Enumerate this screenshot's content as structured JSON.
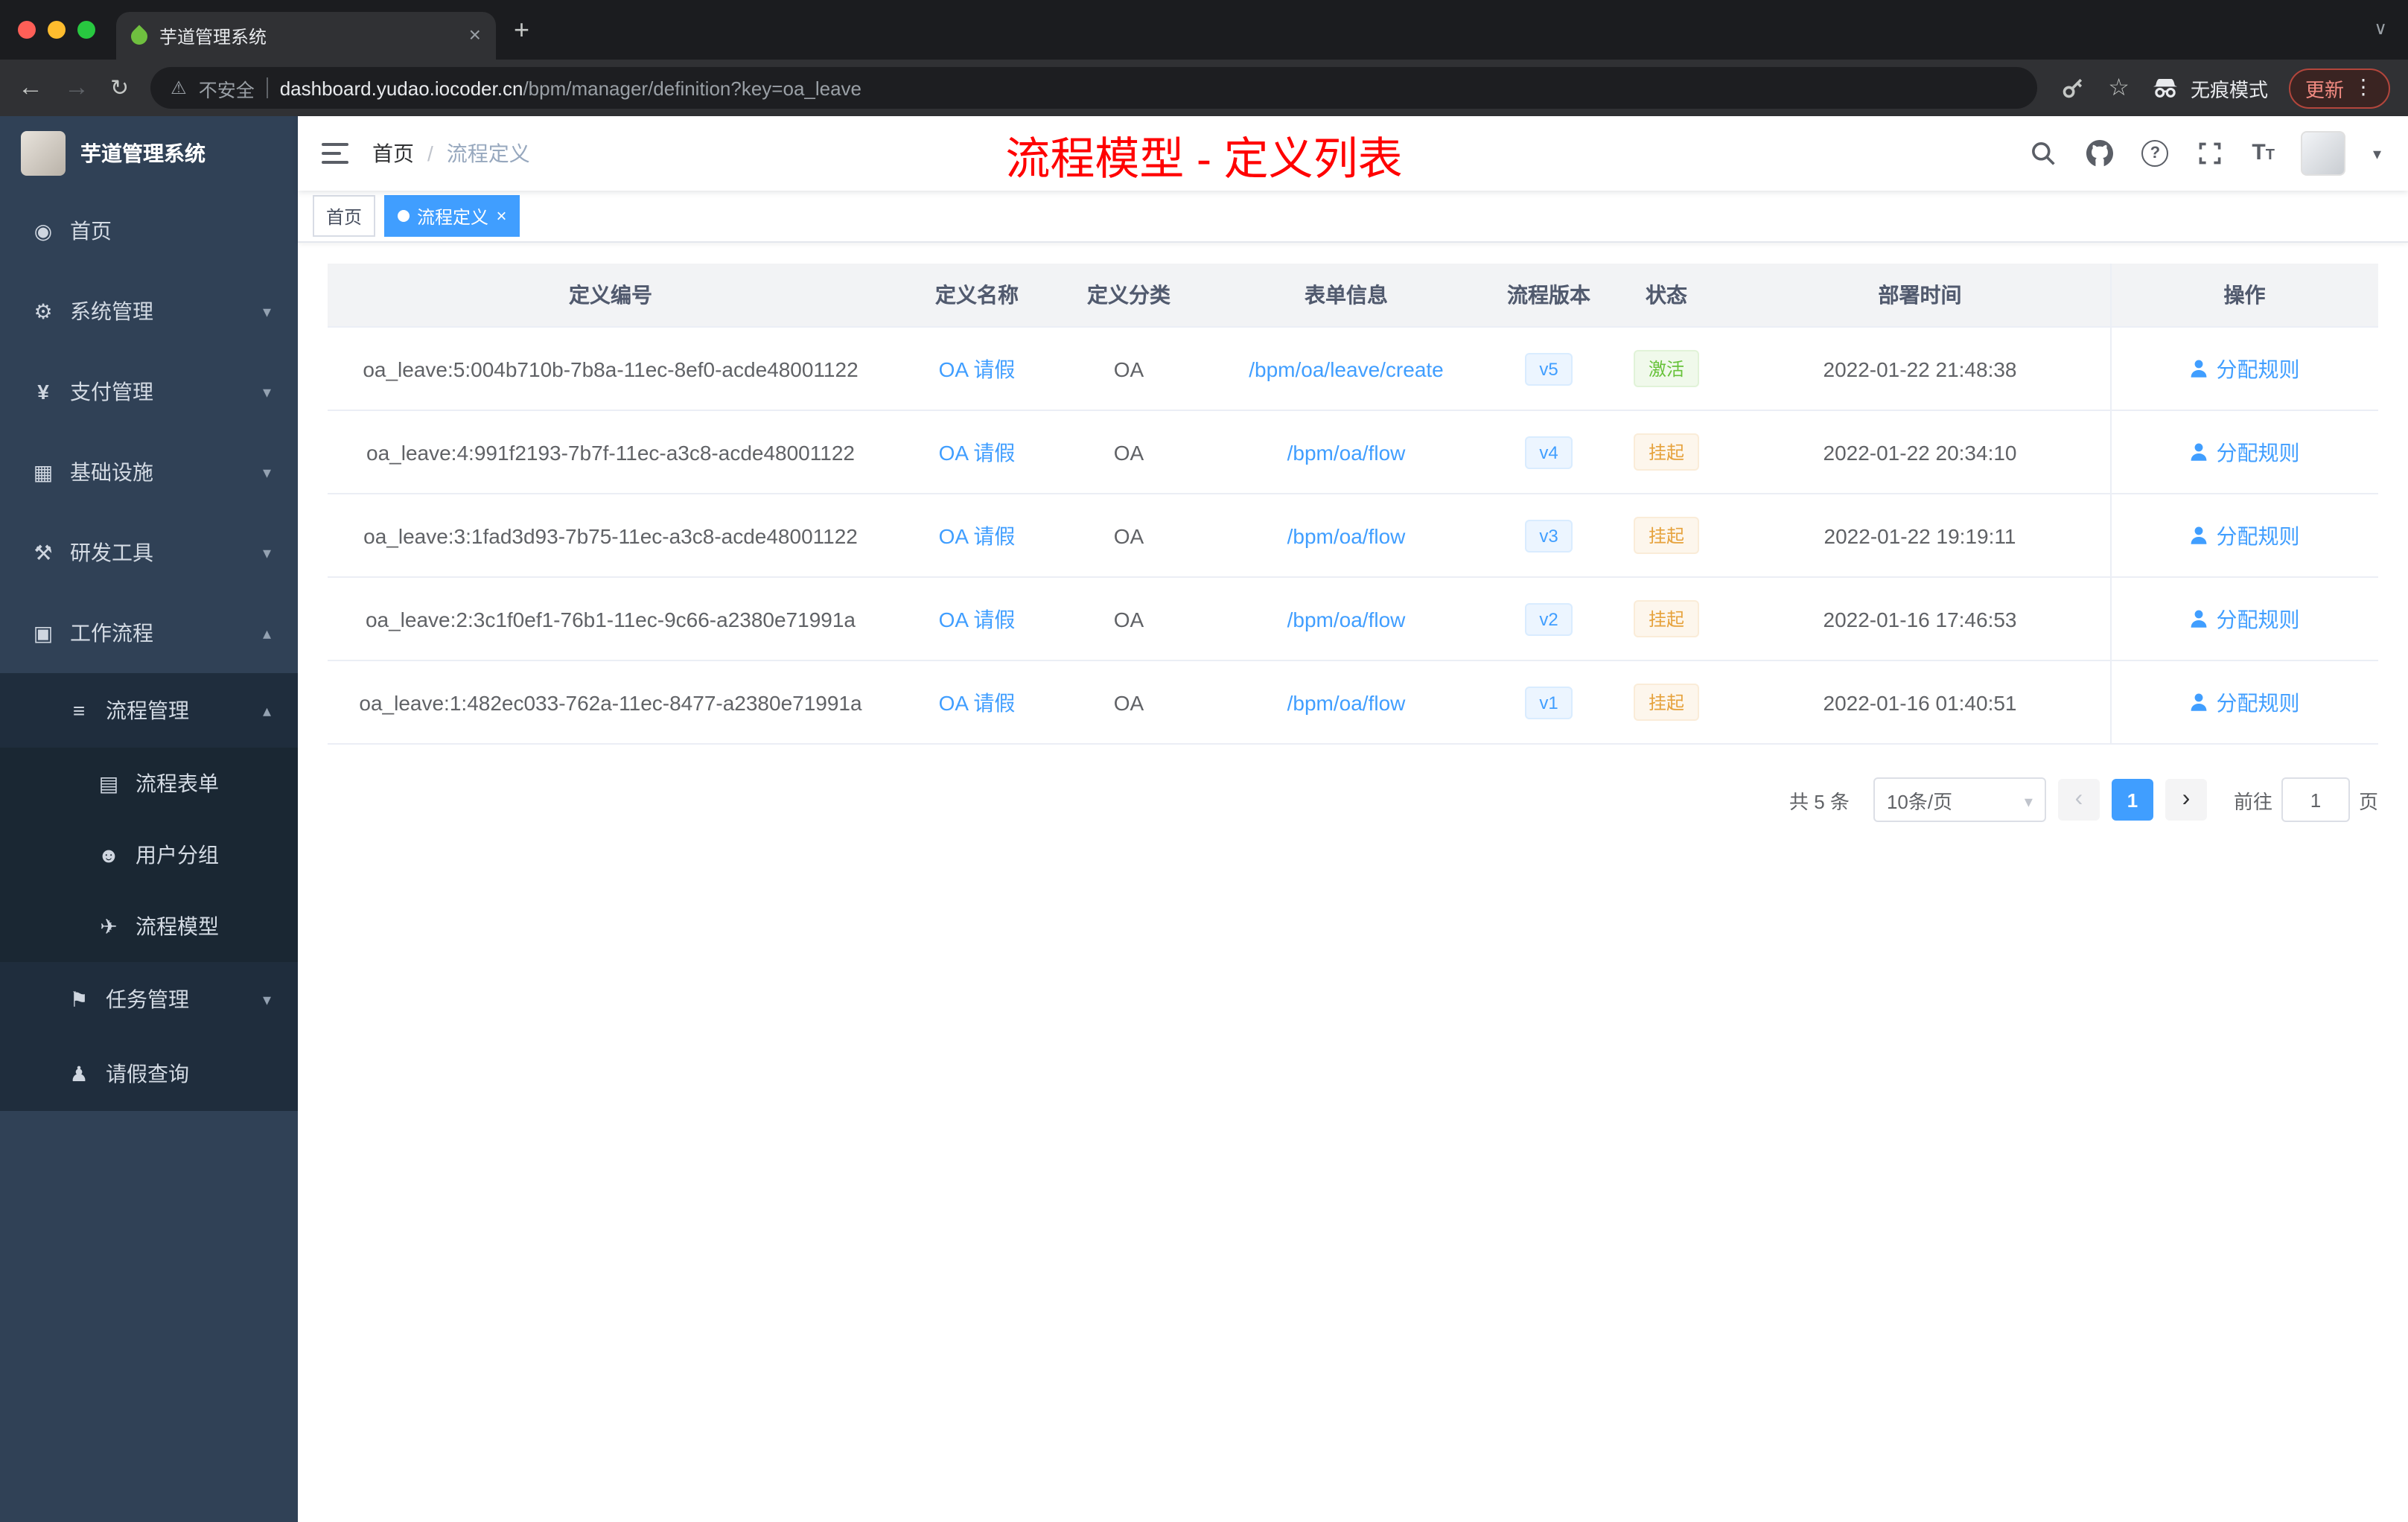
{
  "browser": {
    "tab_title": "芋道管理系统",
    "security_label": "不安全",
    "url_domain": "dashboard.yudao.iocoder.cn",
    "url_path": "/bpm/manager/definition?key=oa_leave",
    "incognito_label": "无痕模式",
    "update_label": "更新"
  },
  "sidebar": {
    "title": "芋道管理系统",
    "items": [
      {
        "label": "首页",
        "icon": "dashboard"
      },
      {
        "label": "系统管理",
        "icon": "gear",
        "arrow": "down"
      },
      {
        "label": "支付管理",
        "icon": "yen",
        "arrow": "down"
      },
      {
        "label": "基础设施",
        "icon": "infrastructure",
        "arrow": "down"
      },
      {
        "label": "研发工具",
        "icon": "tools",
        "arrow": "down"
      },
      {
        "label": "工作流程",
        "icon": "workflow",
        "arrow": "up"
      },
      {
        "label": "流程管理",
        "icon": "process-list",
        "arrow": "up"
      },
      {
        "label": "流程表单",
        "icon": "form-doc"
      },
      {
        "label": "用户分组",
        "icon": "user-group"
      },
      {
        "label": "流程模型",
        "icon": "paper-plane"
      },
      {
        "label": "任务管理",
        "icon": "task",
        "arrow": "down"
      },
      {
        "label": "请假查询",
        "icon": "user"
      }
    ]
  },
  "navbar": {
    "breadcrumb": {
      "items": [
        "首页",
        "流程定义"
      ],
      "separator": "/"
    },
    "annotation": "流程模型 - 定义列表"
  },
  "tags": {
    "items": [
      {
        "label": "首页",
        "active": false
      },
      {
        "label": "流程定义",
        "active": true
      }
    ]
  },
  "table": {
    "columns": [
      "定义编号",
      "定义名称",
      "定义分类",
      "表单信息",
      "流程版本",
      "状态",
      "部署时间",
      "操作"
    ],
    "rows": [
      {
        "id": "oa_leave:5:004b710b-7b8a-11ec-8ef0-acde48001122",
        "name": "OA 请假",
        "category": "OA",
        "form": "/bpm/oa/leave/create",
        "version": "v5",
        "status": "激活",
        "status_type": "success",
        "deploy_time": "2022-01-22 21:48:38",
        "action": "分配规则"
      },
      {
        "id": "oa_leave:4:991f2193-7b7f-11ec-a3c8-acde48001122",
        "name": "OA 请假",
        "category": "OA",
        "form": "/bpm/oa/flow",
        "version": "v4",
        "status": "挂起",
        "status_type": "warning",
        "deploy_time": "2022-01-22 20:34:10",
        "action": "分配规则"
      },
      {
        "id": "oa_leave:3:1fad3d93-7b75-11ec-a3c8-acde48001122",
        "name": "OA 请假",
        "category": "OA",
        "form": "/bpm/oa/flow",
        "version": "v3",
        "status": "挂起",
        "status_type": "warning",
        "deploy_time": "2022-01-22 19:19:11",
        "action": "分配规则"
      },
      {
        "id": "oa_leave:2:3c1f0ef1-76b1-11ec-9c66-a2380e71991a",
        "name": "OA 请假",
        "category": "OA",
        "form": "/bpm/oa/flow",
        "version": "v2",
        "status": "挂起",
        "status_type": "warning",
        "deploy_time": "2022-01-16 17:46:53",
        "action": "分配规则"
      },
      {
        "id": "oa_leave:1:482ec033-762a-11ec-8477-a2380e71991a",
        "name": "OA 请假",
        "category": "OA",
        "form": "/bpm/oa/flow",
        "version": "v1",
        "status": "挂起",
        "status_type": "warning",
        "deploy_time": "2022-01-16 01:40:51",
        "action": "分配规则"
      }
    ]
  },
  "pagination": {
    "total": "共 5 条",
    "page_size": "10条/页",
    "current_page": "1",
    "goto_label": "前往",
    "goto_value": "1",
    "unit_label": "页"
  },
  "colors": {
    "accent": "#409eff",
    "success": "#67c23a",
    "warning": "#e6a23c",
    "annotation": "#ff0000",
    "sidebar_bg": "#304156"
  }
}
